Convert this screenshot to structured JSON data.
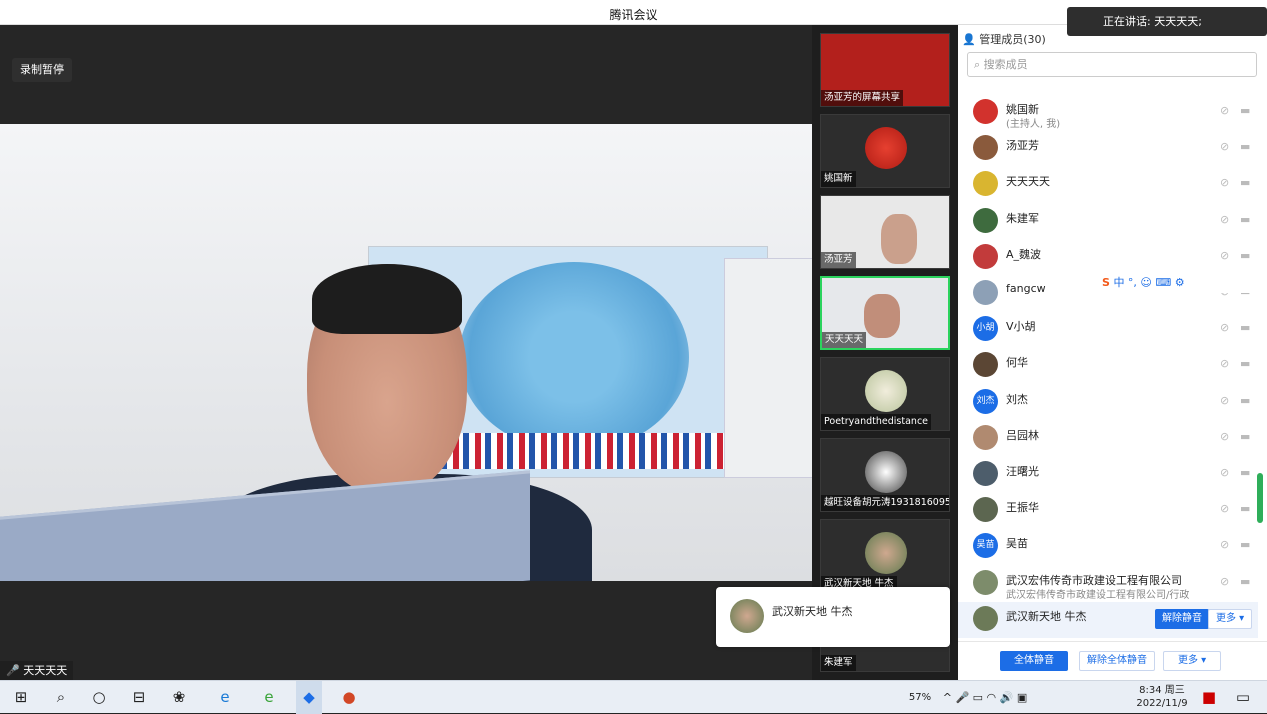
{
  "window": {
    "title": "腾讯会议"
  },
  "stage": {
    "record_label": "录制暂停",
    "speaker_label": "天天天天"
  },
  "speaking": {
    "label": "正在讲话: 天天天天;"
  },
  "gallery": {
    "tiles": [
      {
        "label": "汤亚芳的屏幕共享"
      },
      {
        "label": "姚国新"
      },
      {
        "label": "汤亚芳"
      },
      {
        "label": "天天天天"
      },
      {
        "label": "Poetryandthedistance"
      },
      {
        "label": "越旺设备胡元涛19318160959"
      },
      {
        "label": "武汉新天地 牛杰"
      },
      {
        "label": "朱建军"
      }
    ]
  },
  "popup": {
    "name": "武汉新天地 牛杰"
  },
  "panel": {
    "title": "管理成员(30)",
    "search_placeholder": "搜索成员",
    "members": [
      {
        "name": "姚国新",
        "sub": "(主持人, 我)",
        "avatar": "",
        "color": "#d2322d"
      },
      {
        "name": "汤亚芳",
        "sub": "",
        "avatar": "",
        "color": "#8a5a3c"
      },
      {
        "name": "天天天天",
        "sub": "",
        "avatar": "",
        "color": "#d9b530"
      },
      {
        "name": "朱建军",
        "sub": "",
        "avatar": "",
        "color": "#3e6b3e"
      },
      {
        "name": "A_魏波",
        "sub": "",
        "avatar": "",
        "color": "#c23b3b"
      },
      {
        "name": "fangcw",
        "sub": "",
        "avatar": "",
        "color": "#8da0b6"
      },
      {
        "name": "V小胡",
        "sub": "",
        "avatar": "小胡",
        "color": "#1c6de6"
      },
      {
        "name": "何华",
        "sub": "",
        "avatar": "",
        "color": "#5b4634"
      },
      {
        "name": "刘杰",
        "sub": "",
        "avatar": "刘杰",
        "color": "#1c6de6"
      },
      {
        "name": "吕园林",
        "sub": "",
        "avatar": "",
        "color": "#b08a70"
      },
      {
        "name": "汪曙光",
        "sub": "",
        "avatar": "",
        "color": "#4d5d6b"
      },
      {
        "name": "王振华",
        "sub": "",
        "avatar": "",
        "color": "#5c6650"
      },
      {
        "name": "吴苗",
        "sub": "",
        "avatar": "吴苗",
        "color": "#1c6de6"
      },
      {
        "name": "武汉宏伟传奇市政建设工程有限公司",
        "sub": "武汉宏伟传奇市政建设工程有限公司/行政",
        "avatar": "",
        "color": "#7d8c6b"
      },
      {
        "name": "武汉新天地 牛杰",
        "sub": "",
        "avatar": "",
        "color": "#6c7a58"
      }
    ],
    "unmute_label": "解除静音",
    "more_label": "更多 ▾",
    "mute_all": "全体静音",
    "unmute_all": "解除全体静音",
    "more_bottom": "更多 ▾"
  },
  "ime": {
    "text": "中 °, ☺ ⌨ ⚙"
  },
  "taskbar": {
    "battery": "57%",
    "time": "8:34 周三",
    "date": "2022/11/9"
  }
}
